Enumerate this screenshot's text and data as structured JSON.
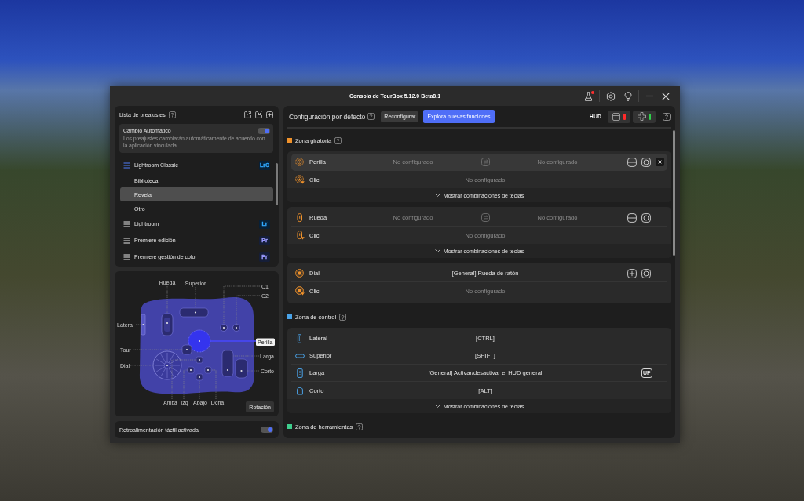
{
  "window": {
    "title": "Consola de TourBox 5.12.0 Beta8.1",
    "lab_alert": true
  },
  "presets": {
    "title": "Lista de preajustes",
    "auto_switch": {
      "label": "Cambio Automático",
      "on": true,
      "description": "Los preajustes cambiarán automáticamente de acuerdo con la aplicación vinculada."
    },
    "items": [
      {
        "name": "Lightroom Classic",
        "badge": "LrC",
        "color": "#31a8ff",
        "active": true,
        "children": [
          {
            "name": "Biblioteca",
            "selected": false
          },
          {
            "name": "Revelar",
            "selected": true
          },
          {
            "name": "Otro",
            "selected": false
          }
        ]
      },
      {
        "name": "Lightroom",
        "badge": "Lr",
        "color": "#31a8ff",
        "active": false
      },
      {
        "name": "Premiere edición",
        "badge": "Pr",
        "color": "#9999ff",
        "active": false
      },
      {
        "name": "Premiere gestión de color",
        "badge": "Pr",
        "color": "#9999ff",
        "active": false
      }
    ]
  },
  "device": {
    "labels": [
      {
        "text": "Rueda",
        "selected": false
      },
      {
        "text": "Superior",
        "selected": false
      },
      {
        "text": "C1",
        "selected": false
      },
      {
        "text": "C2",
        "selected": false
      },
      {
        "text": "Lateral",
        "selected": false
      },
      {
        "text": "Perilla",
        "selected": true
      },
      {
        "text": "Tour",
        "selected": false
      },
      {
        "text": "Larga",
        "selected": false
      },
      {
        "text": "Dial",
        "selected": false
      },
      {
        "text": "Corto",
        "selected": false
      },
      {
        "text": "Arriba",
        "selected": false
      },
      {
        "text": "Izq",
        "selected": false
      },
      {
        "text": "Abajo",
        "selected": false
      },
      {
        "text": "Dcha",
        "selected": false
      }
    ],
    "rotate_button": "Rotación"
  },
  "haptic": {
    "label": "Retroalimentación táctil activada",
    "on": true
  },
  "config": {
    "title": "Configuración por defecto",
    "reconfigure_button": "Reconfigurar",
    "explore_button": "Explora nuevas funciones",
    "hud": {
      "label": "HUD",
      "toggles": [
        {
          "on": false
        },
        {
          "on": true
        }
      ]
    }
  },
  "zones": [
    {
      "title": "Zona giratoria",
      "color": "#f0922b",
      "cards": [
        {
          "rows": [
            {
              "kind": "knob",
              "label": "Perilla",
              "selected": true,
              "configured": false,
              "left": "No configurado",
              "right": "No configurado",
              "buttons": true
            },
            {
              "kind": "knob-press",
              "label": "Clic",
              "selected": false,
              "configured": false,
              "value": "No configurado"
            }
          ],
          "toggle": "Mostrar combinaciones de teclas"
        },
        {
          "rows": [
            {
              "kind": "wheel",
              "label": "Rueda",
              "selected": false,
              "configured": false,
              "left": "No configurado",
              "right": "No configurado",
              "buttons": true
            },
            {
              "kind": "wheel-press",
              "label": "Clic",
              "selected": false,
              "configured": false,
              "value": "No configurado"
            }
          ],
          "toggle": "Mostrar combinaciones de teclas"
        },
        {
          "rows": [
            {
              "kind": "dial",
              "label": "Dial",
              "selected": false,
              "configured": true,
              "value": "[General] Rueda de ratón",
              "buttons": true
            },
            {
              "kind": "dial-press",
              "label": "Clic",
              "selected": false,
              "configured": false,
              "value": "No configurado"
            }
          ]
        }
      ]
    },
    {
      "title": "Zona de control",
      "color": "#4aa3e8",
      "cards": [
        {
          "rows": [
            {
              "kind": "side",
              "label": "Lateral",
              "selected": false,
              "configured": true,
              "value": "[CTRL]"
            },
            {
              "kind": "top",
              "label": "Superior",
              "selected": false,
              "configured": true,
              "value": "[SHIFT]"
            },
            {
              "kind": "tall",
              "label": "Larga",
              "selected": false,
              "configured": true,
              "value": "[General] Activar/desactivar el HUD general",
              "tag": "UP"
            },
            {
              "kind": "short",
              "label": "Corto",
              "selected": false,
              "configured": true,
              "value": "[ALT]"
            }
          ],
          "toggle": "Mostrar combinaciones de teclas"
        }
      ]
    },
    {
      "title": "Zona de herramientas",
      "color": "#3fcf8e"
    }
  ]
}
